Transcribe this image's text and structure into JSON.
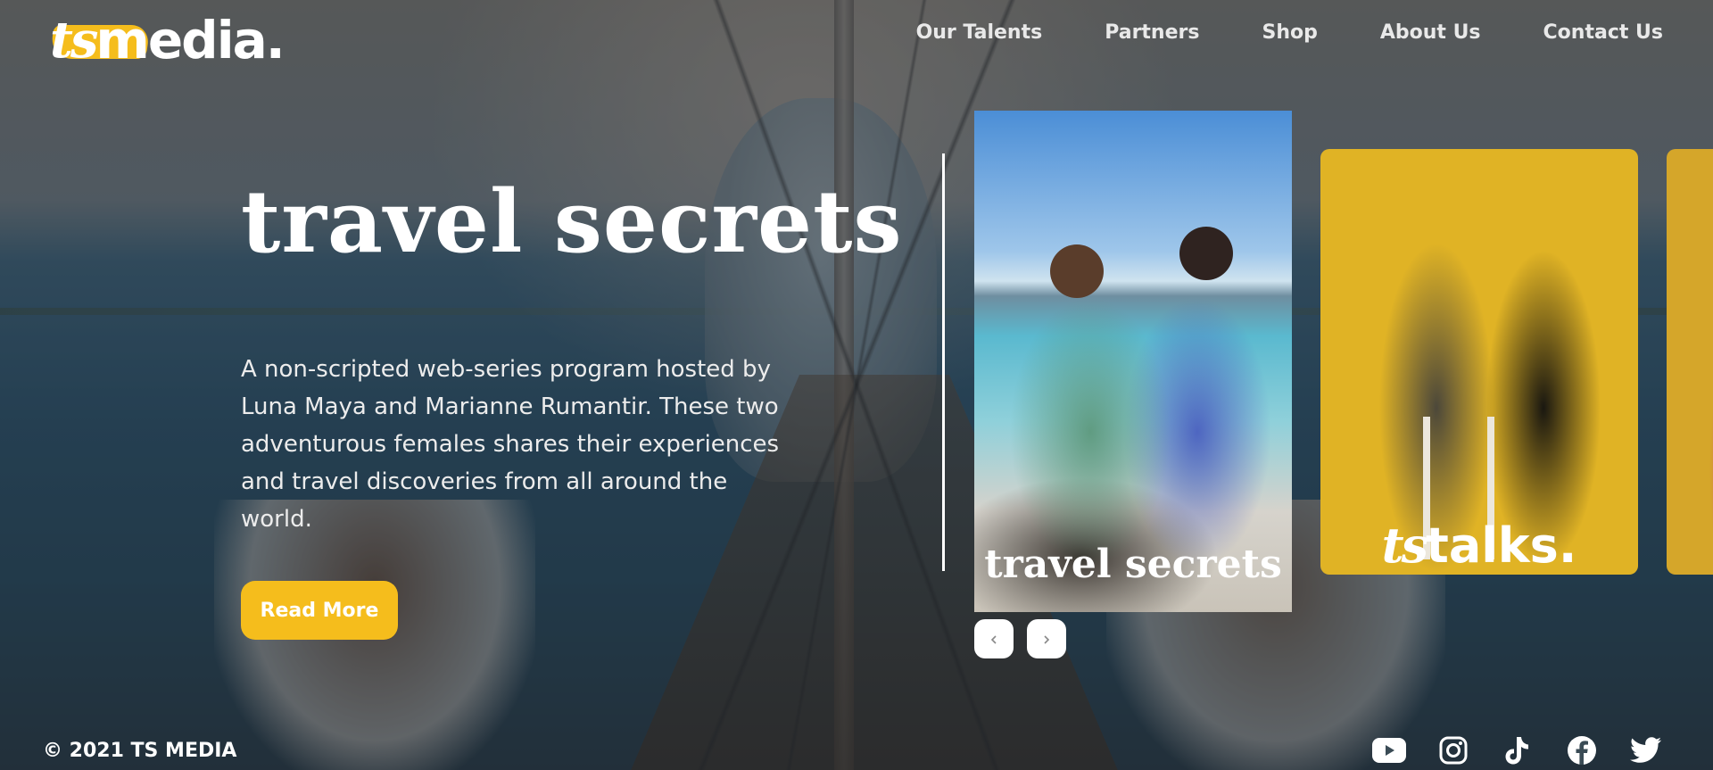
{
  "brand": {
    "logo_ts": "ts",
    "logo_media": "media.",
    "accent_color": "#f5bd1c"
  },
  "nav": {
    "items": [
      {
        "label": "Our Talents"
      },
      {
        "label": "Partners"
      },
      {
        "label": "Shop"
      },
      {
        "label": "About Us"
      },
      {
        "label": "Contact Us"
      }
    ]
  },
  "hero": {
    "title": "travel secrets",
    "description": "A non-scripted web-series program hosted by Luna Maya and Marianne Rumantir. These two adventurous females shares their experiences and travel discoveries from all around the world.",
    "cta_label": "Read More"
  },
  "carousel": {
    "cards": [
      {
        "caption": "travel secrets"
      },
      {
        "caption_ts": "ts",
        "caption_talks": "talks."
      },
      {
        "caption": ""
      }
    ],
    "prev_icon": "chevron-left-icon",
    "next_icon": "chevron-right-icon"
  },
  "footer": {
    "copyright": "© 2021 TS MEDIA",
    "socials": [
      "youtube-icon",
      "instagram-icon",
      "tiktok-icon",
      "facebook-icon",
      "twitter-icon"
    ]
  }
}
